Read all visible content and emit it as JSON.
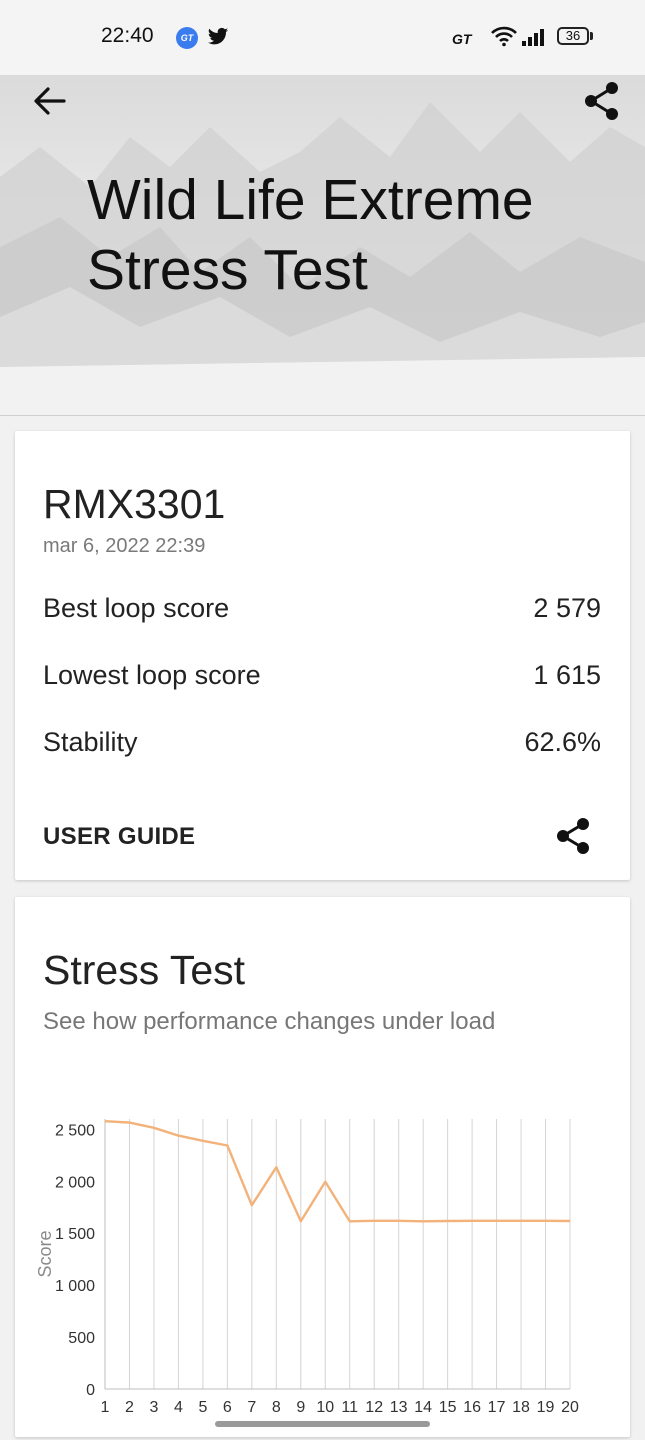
{
  "status_bar": {
    "time": "22:40",
    "battery": "36",
    "mode_badge": "GT",
    "app_badge": "GT",
    "icons": [
      "gt-app-icon",
      "twitter-icon",
      "gt-mode-icon",
      "wifi-icon",
      "signal-icon",
      "battery-icon"
    ]
  },
  "header": {
    "title": "Wild Life Extreme Stress Test",
    "icons": [
      "back-arrow-icon",
      "share-icon"
    ]
  },
  "result": {
    "device": "RMX3301",
    "date": "mar 6, 2022 22:39",
    "rows": [
      {
        "label": "Best loop score",
        "value": "2 579"
      },
      {
        "label": "Lowest loop score",
        "value": "1 615"
      },
      {
        "label": "Stability",
        "value": "62.6%"
      }
    ],
    "user_guide": "USER GUIDE"
  },
  "stress": {
    "title": "Stress Test",
    "subtitle": "See how performance changes under load"
  },
  "chart_data": {
    "type": "line",
    "ylabel": "Score",
    "xlabel": "",
    "ylim": [
      0,
      2600
    ],
    "yticks": [
      0,
      500,
      1000,
      1500,
      2000,
      2500
    ],
    "ytick_labels": [
      "0",
      "500",
      "1 000",
      "1 500",
      "2 000",
      "2 500"
    ],
    "x": [
      1,
      2,
      3,
      4,
      5,
      6,
      7,
      8,
      9,
      10,
      11,
      12,
      13,
      14,
      15,
      16,
      17,
      18,
      19,
      20
    ],
    "series": [
      {
        "color": "#f2b27a",
        "values": [
          2579,
          2565,
          2515,
          2440,
          2390,
          2345,
          1770,
          2135,
          1615,
          1995,
          1615,
          1620,
          1620,
          1615,
          1618,
          1620,
          1620,
          1620,
          1620,
          1618
        ]
      }
    ],
    "grid": true,
    "legend": "none"
  }
}
